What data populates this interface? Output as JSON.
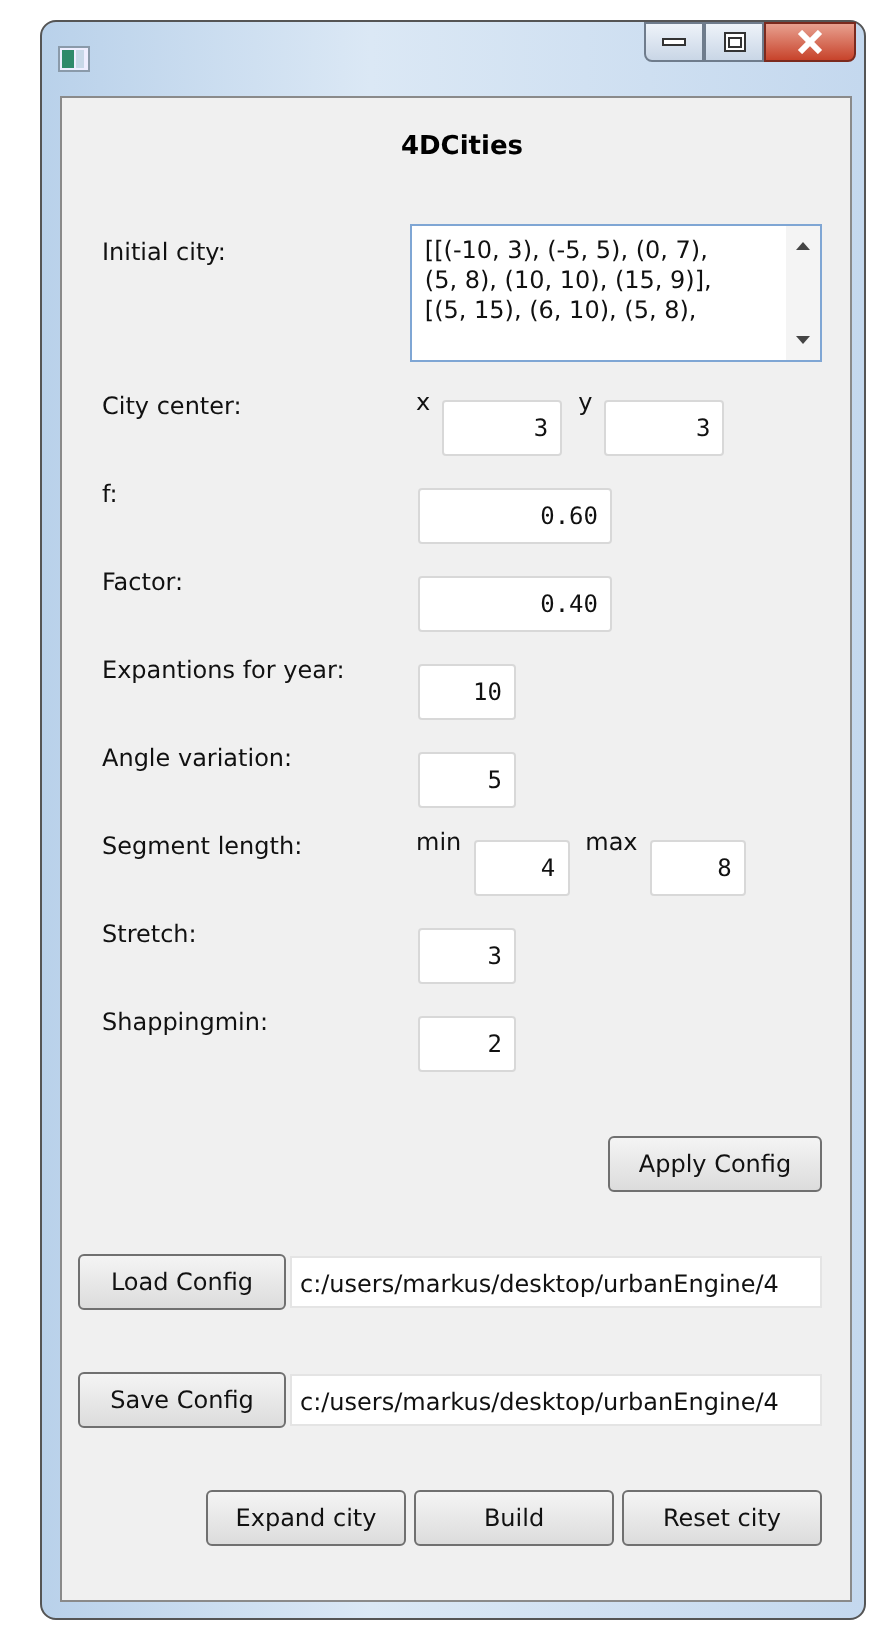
{
  "heading": "4DCities",
  "initial_city": {
    "label": "Initial city:",
    "lines": [
      "[[(-10, 3), (-5, 5), (0, 7),",
      "(5, 8), (10, 10), (15, 9)],",
      "[(5, 15), (6, 10), (5, 8),"
    ]
  },
  "fields": [
    {
      "kind": "pair",
      "label": "City center:",
      "inputs": [
        {
          "prefix": "x",
          "value": "3"
        },
        {
          "prefix": "y",
          "value": "3"
        }
      ]
    },
    {
      "kind": "wide",
      "label": "f:",
      "value": "0.60"
    },
    {
      "kind": "wide",
      "label": "Factor:",
      "value": "0.40"
    },
    {
      "kind": "narrow",
      "label": "Expantions for year:",
      "value": "10"
    },
    {
      "kind": "narrow",
      "label": "Angle variation:",
      "value": "5"
    },
    {
      "kind": "pair",
      "label": "Segment length:",
      "inputs": [
        {
          "prefix": "min",
          "value": "4"
        },
        {
          "prefix": "max",
          "value": "8"
        }
      ]
    },
    {
      "kind": "narrow",
      "label": "Stretch:",
      "value": "3"
    },
    {
      "kind": "narrow",
      "label": "Shappingmin:",
      "value": "2"
    }
  ],
  "apply_button": "Apply Config",
  "file_rows": [
    {
      "button": "Load Config",
      "path": "c:/users/markus/desktop/urbanEngine/4"
    },
    {
      "button": "Save Config",
      "path": "c:/users/markus/desktop/urbanEngine/4"
    }
  ],
  "bottom_buttons": [
    "Expand city",
    "Build",
    "Reset city"
  ]
}
